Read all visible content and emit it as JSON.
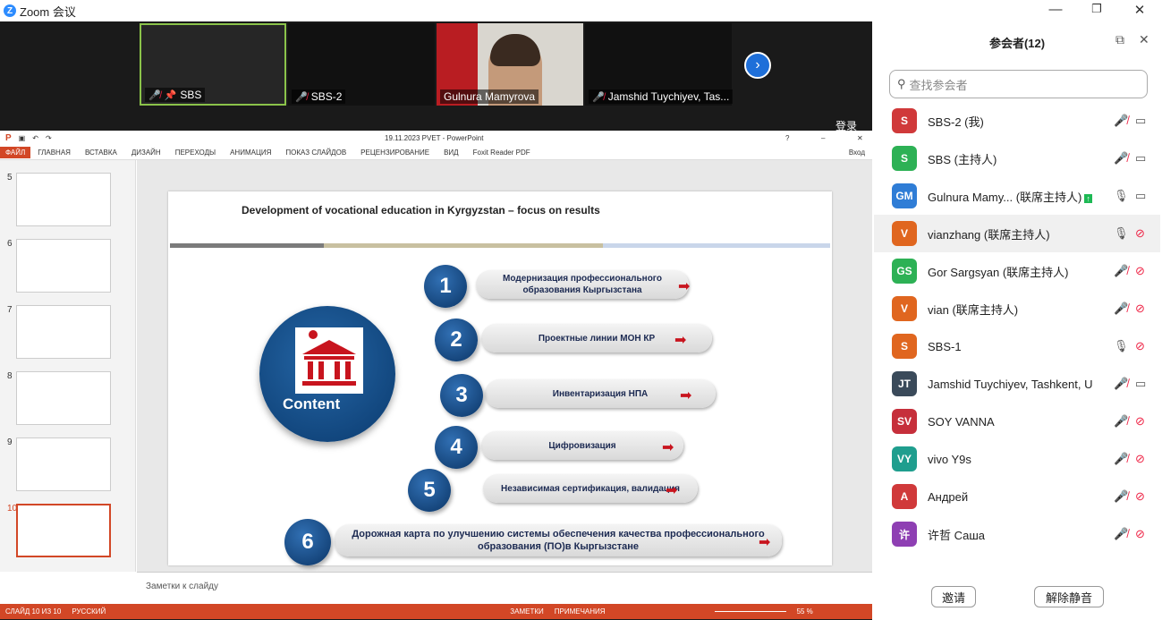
{
  "app": {
    "title": "Zoom 会议"
  },
  "window_controls": {
    "minimize": "—",
    "restore": "❐",
    "close": "✕"
  },
  "video_tiles": [
    {
      "name": "SBS",
      "muted": true
    },
    {
      "name": "SBS-2",
      "muted": true
    },
    {
      "name": "Gulnura Mamyrova",
      "muted": false
    },
    {
      "name": "Jamshid Tuychiyev, Tas...",
      "muted": true
    }
  ],
  "next_page": "›",
  "login": "登录",
  "ppt": {
    "window_title": "19.11.2023 PVET - PowerPoint",
    "signin": "Вход",
    "tabs": [
      "ФАЙЛ",
      "ГЛАВНАЯ",
      "ВСТАВКА",
      "ДИЗАЙН",
      "ПЕРЕХОДЫ",
      "АНИМАЦИЯ",
      "ПОКАЗ СЛАЙДОВ",
      "РЕЦЕНЗИРОВАНИЕ",
      "ВИД",
      "Foxit Reader PDF"
    ],
    "thumb_numbers": [
      "5",
      "6",
      "7",
      "8",
      "9",
      "10"
    ],
    "notes_placeholder": "Заметки к слайду",
    "status": {
      "slide": "СЛАЙД 10 ИЗ 10",
      "lang": "РУССКИЙ",
      "notes": "ЗАМЕТКИ",
      "comments": "ПРИМЕЧАНИЯ",
      "zoom": "55 %"
    },
    "slide": {
      "title": "Development of vocational education in Kyrgyzstan – focus on results",
      "content_label": "Content",
      "items": [
        {
          "num": "1",
          "text": "Модернизация профессионального образования Кыргызстана"
        },
        {
          "num": "2",
          "text": "Проектные линии МОН КР"
        },
        {
          "num": "3",
          "text": "Инвентаризация НПА"
        },
        {
          "num": "4",
          "text": "Цифровизация"
        },
        {
          "num": "5",
          "text": "Независимая сертификация, валидация"
        },
        {
          "num": "6",
          "text": "Дорожная карта по улучшению системы обеспечения качества профессионального образования (ПО)в Кыргызстане"
        }
      ]
    }
  },
  "panel": {
    "title": "参会者(12)",
    "search_placeholder": "查找参会者",
    "participants": [
      {
        "initials": "S",
        "name": "SBS-2 (我)",
        "color": "#d0393a",
        "mic": "muted",
        "cam": "on-icon"
      },
      {
        "initials": "S",
        "name": "SBS (主持人)",
        "color": "#2db155",
        "mic": "muted",
        "cam": "on-icon"
      },
      {
        "initials": "GM",
        "name": "Gulnura Mamy... (联席主持人)",
        "color": "#2f7dd6",
        "mic": "on",
        "cam": "on-icon",
        "sharing": true
      },
      {
        "initials": "V",
        "name": "vianzhang (联席主持人)",
        "color": "#e0661f",
        "mic": "on",
        "cam": "off"
      },
      {
        "initials": "GS",
        "name": "Gor Sargsyan (联席主持人)",
        "color": "#2db155",
        "mic": "muted",
        "cam": "off"
      },
      {
        "initials": "V",
        "name": "vian (联席主持人)",
        "color": "#e0661f",
        "mic": "muted",
        "cam": "off"
      },
      {
        "initials": "S",
        "name": "SBS-1",
        "color": "#e0661f",
        "mic": "on",
        "cam": "off"
      },
      {
        "initials": "JT",
        "name": "Jamshid Tuychiyev, Tashkent, Uz...",
        "color": "#3a4a5a",
        "mic": "muted",
        "cam": "on-icon"
      },
      {
        "initials": "SV",
        "name": "SOY VANNA",
        "color": "#c62f3b",
        "mic": "muted",
        "cam": "off"
      },
      {
        "initials": "VY",
        "name": "vivo Y9s",
        "color": "#1f9e8e",
        "mic": "muted",
        "cam": "off"
      },
      {
        "initials": "A",
        "name": "Андрей",
        "color": "#d0393a",
        "mic": "muted",
        "cam": "off"
      },
      {
        "initials": "许",
        "name": "许哲 Саша",
        "color": "#8e3fb3",
        "mic": "muted",
        "cam": "off"
      }
    ],
    "invite": "邀请",
    "unmute": "解除静音"
  }
}
